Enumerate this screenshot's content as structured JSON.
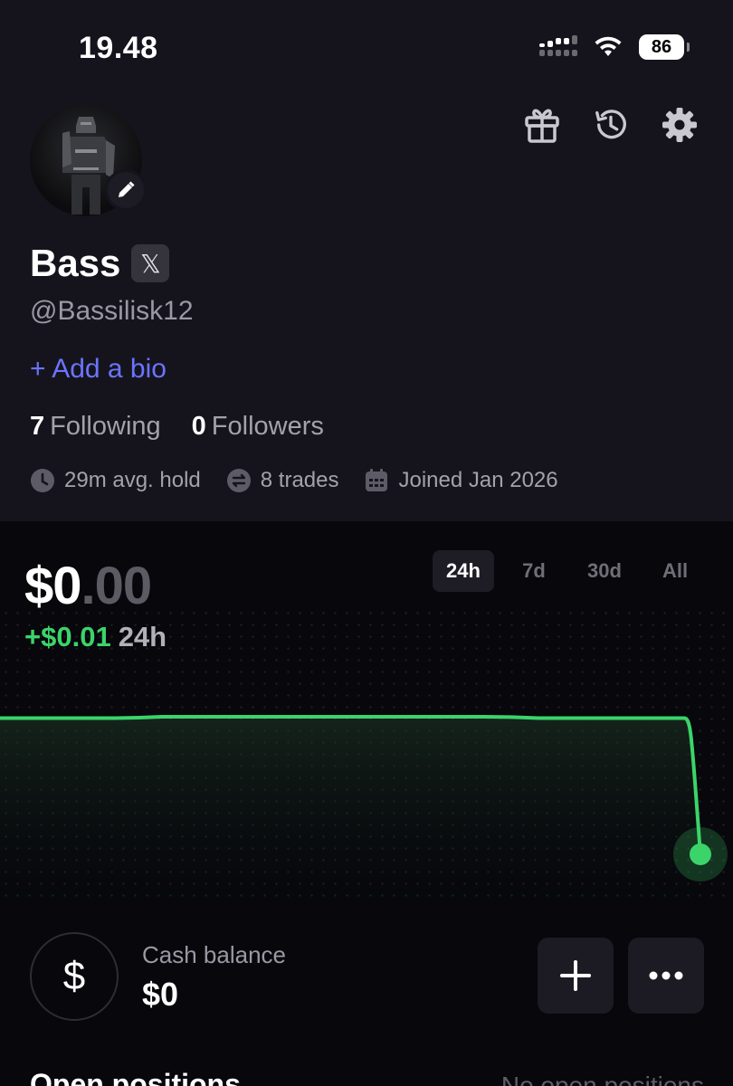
{
  "status_bar": {
    "time": "19.48",
    "battery": "86"
  },
  "profile": {
    "name": "Bass",
    "x_badge": "𝕏",
    "handle": "@Bassilisk12",
    "add_bio": "+ Add a bio",
    "following_count": "7",
    "following_label": "Following",
    "followers_count": "0",
    "followers_label": "Followers",
    "stats": {
      "avg_hold": "29m avg. hold",
      "trades": "8 trades",
      "joined": "Joined Jan 2026"
    }
  },
  "header_icons": [
    "gift-icon",
    "history-icon",
    "settings-icon"
  ],
  "portfolio": {
    "balance_main": "$0",
    "balance_cents": ".00",
    "change_value": "+$0.01",
    "change_period": "24h",
    "ranges": [
      "24h",
      "7d",
      "30d",
      "All"
    ],
    "active_range": "24h"
  },
  "chart_data": {
    "type": "line",
    "x": [
      0,
      1,
      2,
      3,
      4,
      5,
      6,
      7,
      8,
      9,
      10,
      11,
      12,
      13
    ],
    "values": [
      0.01,
      0.01,
      0.01,
      0.0101,
      0.0101,
      0.0101,
      0.0101,
      0.0101,
      0.0101,
      0.0101,
      0.01,
      0.01,
      0.01,
      0.0
    ],
    "color": "#3bd46a",
    "grid": false
  },
  "cash": {
    "symbol": "$",
    "label": "Cash balance",
    "value": "$0"
  },
  "positions": {
    "title": "Open positions",
    "empty_text": "No open positions"
  },
  "colors": {
    "accent_link": "#6b74ff",
    "positive": "#3bd46a",
    "profile_bg": "#15141d",
    "portfolio_bg": "#07070c"
  }
}
